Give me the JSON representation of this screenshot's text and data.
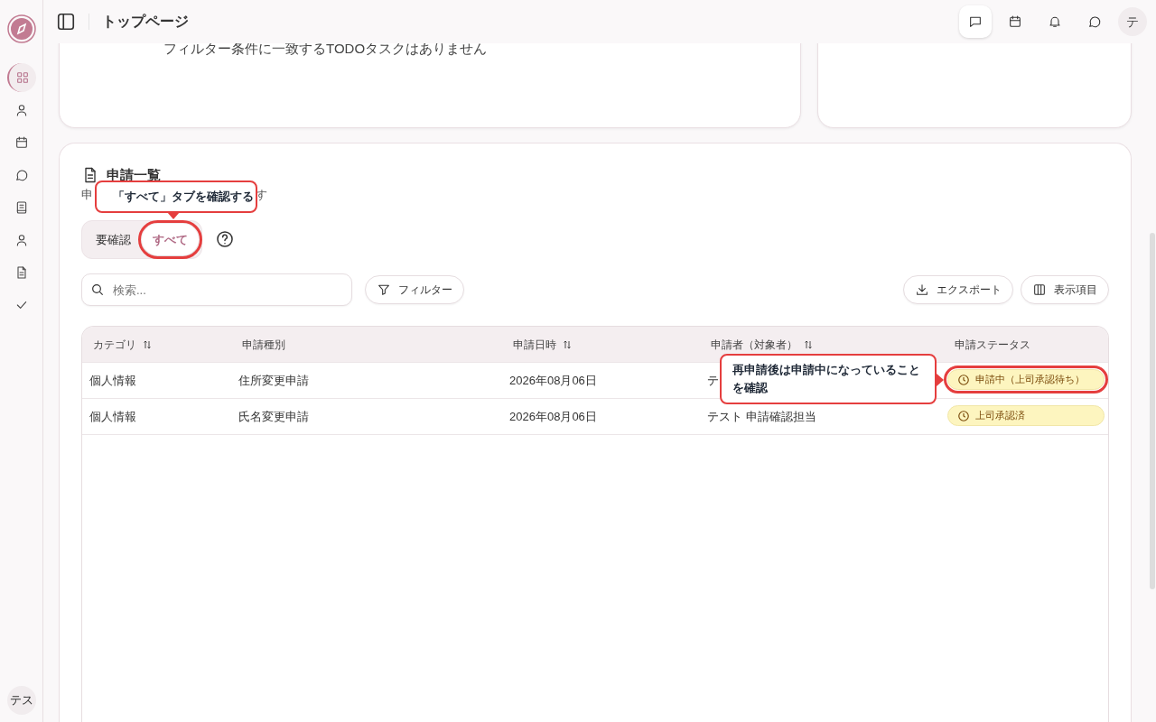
{
  "sidebar": {
    "items": [
      {
        "kind": "grid",
        "selected": true
      },
      {
        "kind": "person",
        "selected": false
      },
      {
        "kind": "calendar",
        "selected": false
      },
      {
        "kind": "chat",
        "selected": false
      },
      {
        "kind": "book",
        "selected": false
      },
      {
        "kind": "person",
        "selected": false
      },
      {
        "kind": "document",
        "selected": false
      },
      {
        "kind": "check",
        "selected": false
      }
    ],
    "user": "テス"
  },
  "topbar": {
    "title": "トップページ",
    "actions": [
      {
        "kind": "message",
        "selected": true
      },
      {
        "kind": "calendar",
        "selected": false
      },
      {
        "kind": "bell",
        "selected": false
      },
      {
        "kind": "chat",
        "selected": false
      }
    ],
    "avatar": "テ"
  },
  "todo_card": {
    "empty_message": "フィルター条件に一致するTODOタスクはありません"
  },
  "applications": {
    "title": "申請一覧",
    "description_parts": [
      "申",
      "す"
    ],
    "tabs": [
      {
        "label": "要確認",
        "selected": false,
        "highlighted": false
      },
      {
        "label": "すべて",
        "selected": true,
        "highlighted": true
      }
    ],
    "search": {
      "placeholder": "検索..."
    },
    "filter_button": "フィルター",
    "export_button": "エクスポート",
    "columns_button": "表示項目",
    "table": {
      "columns": [
        {
          "label": "カテゴリ",
          "sortable": true
        },
        {
          "label": "申請種別",
          "sortable": false
        },
        {
          "label": "申請日時",
          "sortable": true
        },
        {
          "label": "申請者（対象者）",
          "sortable": true
        },
        {
          "label": "申請ステータス",
          "sortable": false
        }
      ],
      "rows": [
        {
          "cells": [
            "個人情報",
            "住所変更申請",
            "2026年08月06日",
            "テ"
          ],
          "status": "申請中（上司承認待ち）",
          "highlighted": true
        },
        {
          "cells": [
            "個人情報",
            "氏名変更申請",
            "2026年08月06日",
            "テスト 申請確認担当"
          ],
          "status": "上司承認済",
          "highlighted": false
        }
      ]
    }
  },
  "callouts": [
    {
      "text": "「すべて」タブを確認する"
    },
    {
      "text": "再申請後は申請中になっていることを確認"
    }
  ]
}
